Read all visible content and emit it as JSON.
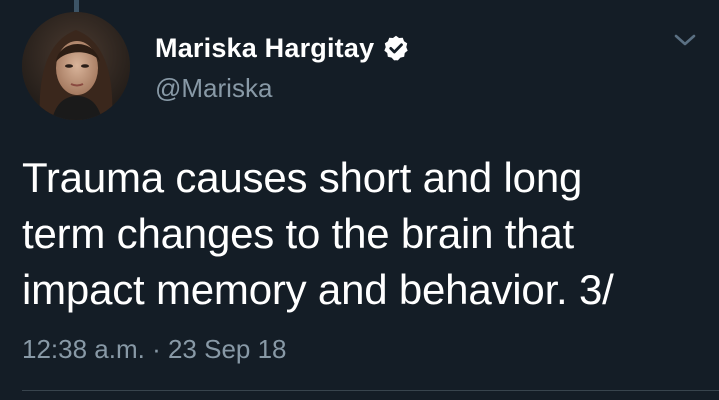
{
  "user": {
    "display_name": "Mariska Hargitay",
    "handle": "@Mariska",
    "verified": true
  },
  "tweet": {
    "text_lines": [
      "Trauma causes short and long",
      "term changes to the brain that",
      "impact memory and behavior. 3/"
    ],
    "timestamp": "12:38 a.m. · 23 Sep 18"
  },
  "icons": {
    "verified": "verified-badge-icon",
    "menu": "chevron-down-icon"
  },
  "colors": {
    "background": "#141d26",
    "primary_text": "#ffffff",
    "secondary_text": "#8899a6",
    "divider": "#38444d"
  }
}
